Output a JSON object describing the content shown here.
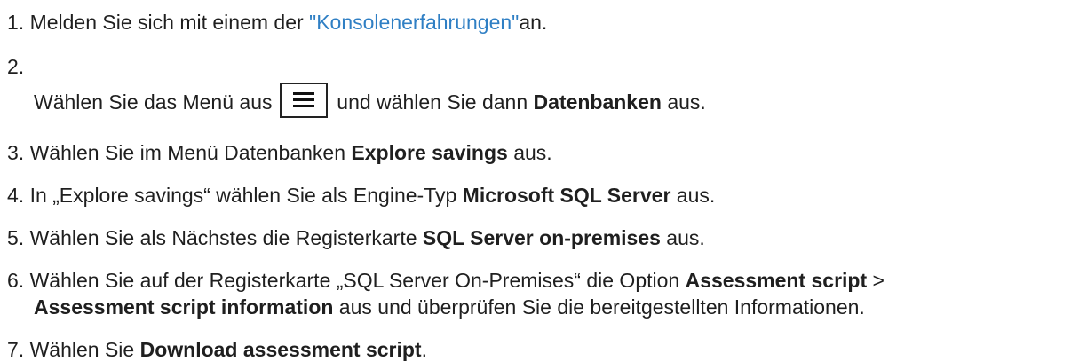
{
  "steps": [
    {
      "num": "1.",
      "pre": "Melden Sie sich mit einem der ",
      "link": "\"Konsolenerfahrungen\"",
      "post": "an."
    },
    {
      "num": "2.",
      "pre": "Wählen Sie das Menü aus ",
      "post": " und wählen Sie dann ",
      "bold": "Datenbanken",
      "tail": " aus."
    },
    {
      "num": "3.",
      "pre": "Wählen Sie im Menü Datenbanken ",
      "bold": "Explore savings",
      "tail": " aus."
    },
    {
      "num": "4.",
      "pre": "In „Explore savings“ wählen Sie als Engine-Typ ",
      "bold": "Microsoft SQL Server",
      "tail": " aus."
    },
    {
      "num": "5.",
      "pre": "Wählen Sie als Nächstes die Registerkarte ",
      "bold": "SQL Server on-premises",
      "tail": " aus."
    },
    {
      "num": "6.",
      "pre": "Wählen Sie auf der Registerkarte „SQL Server On-Premises“ die Option ",
      "bold": "Assessment script",
      "sep": " >",
      "bold2": "Assessment script information",
      "tail": " aus und überprüfen Sie die bereitgestellten Informationen."
    },
    {
      "num": "7.",
      "pre": "Wählen Sie ",
      "bold": "Download assessment script",
      "tail": "."
    }
  ],
  "icons": {
    "menu": "hamburger-menu-icon"
  }
}
